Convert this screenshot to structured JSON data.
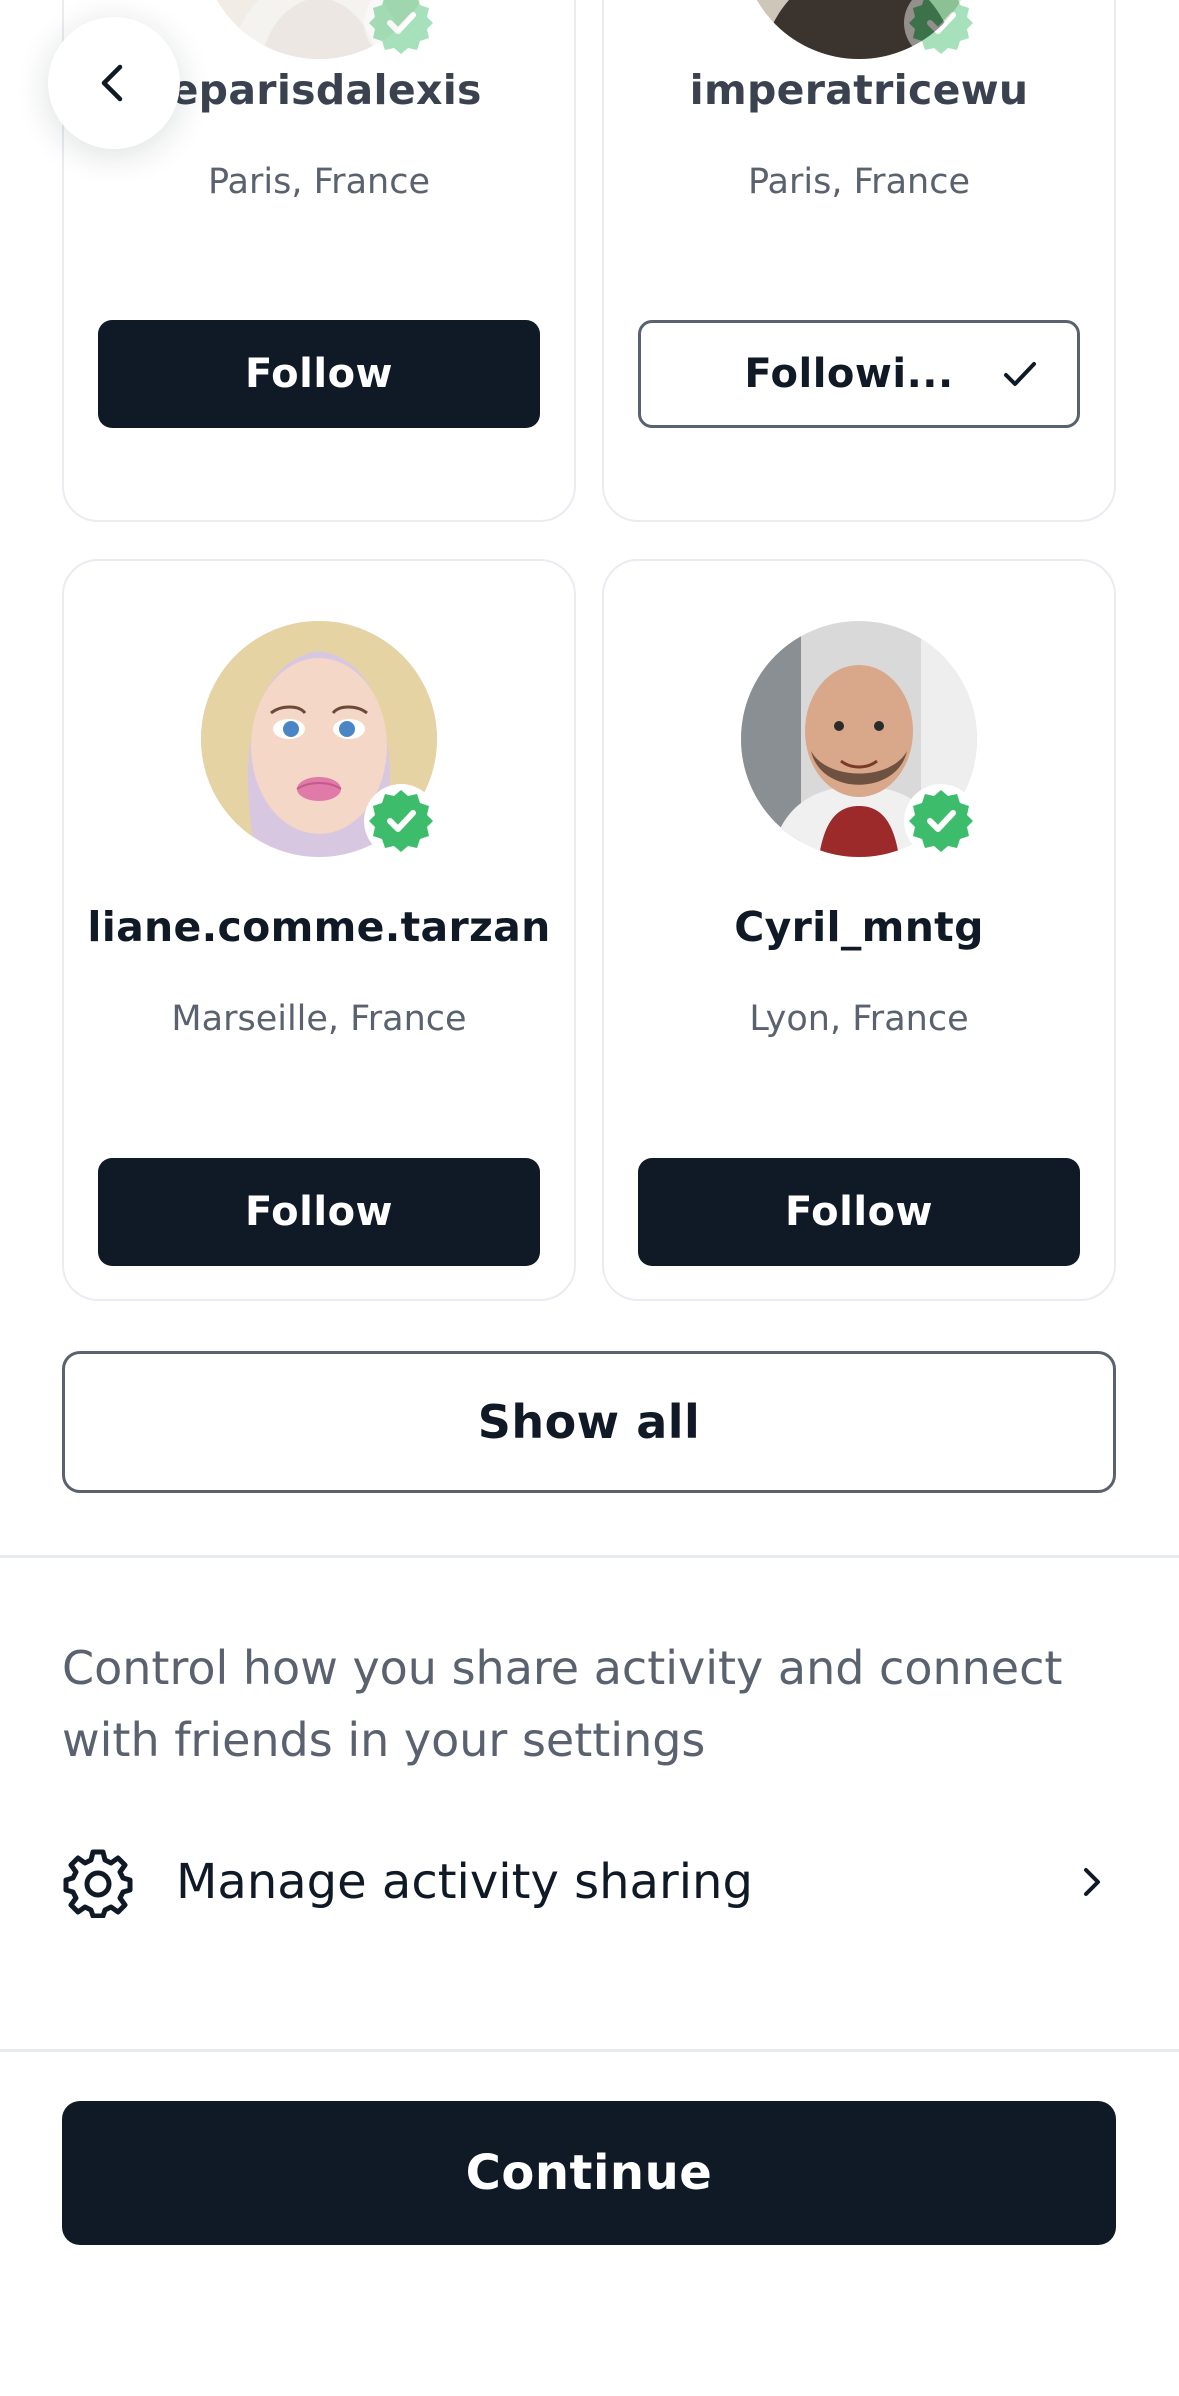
{
  "suggestions": [
    {
      "username": "leparisdalexis",
      "location": "Paris, France",
      "button": "Follow",
      "state": "follow"
    },
    {
      "username": "imperatricewu",
      "location": "Paris, France",
      "button": "Followi...",
      "state": "following"
    },
    {
      "username": "liane.comme.tarzan",
      "location": "Marseille, France",
      "button": "Follow",
      "state": "follow"
    },
    {
      "username": "Cyril_mntg",
      "location": "Lyon, France",
      "button": "Follow",
      "state": "follow"
    }
  ],
  "show_all": "Show all",
  "settings": {
    "description": "Control how you share activity and connect with friends in your settings",
    "manage_label": "Manage activity sharing"
  },
  "continue_label": "Continue",
  "icons": {
    "back": "chevron-left-icon",
    "verified": "verified-badge-icon",
    "check": "check-icon",
    "settings": "gear-icon",
    "row_chevron": "chevron-right-icon"
  },
  "colors": {
    "primary_dark": "#101a26",
    "verified_green": "#3dbd6b",
    "muted_text": "#5a6270",
    "card_border": "#e9ecf1"
  }
}
